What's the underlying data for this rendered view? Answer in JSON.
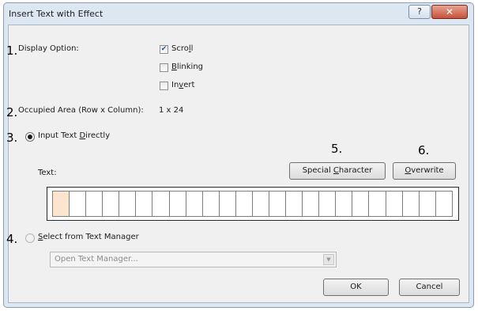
{
  "window": {
    "title": "Insert Text with Effect",
    "help_icon_glyph": "?",
    "close_icon_glyph": "✕"
  },
  "callouts": [
    "1.",
    "2.",
    "3.",
    "4.",
    "5.",
    "6."
  ],
  "display_option": {
    "label": "Display Option:",
    "checkboxes": [
      {
        "label": "Scroll",
        "checked": true
      },
      {
        "label": "Blinking",
        "checked": false
      },
      {
        "label": "Invert",
        "checked": false
      }
    ]
  },
  "occupied_area": {
    "label": "Occupied Area (Row x Column):",
    "value": "1 x 24"
  },
  "input_direct": {
    "label": "Input Text Directly",
    "selected": true
  },
  "text_field": {
    "label": "Text:",
    "columns": 24
  },
  "buttons": {
    "special_character": "Special Character",
    "overwrite": "Overwrite",
    "ok": "OK",
    "cancel": "Cancel"
  },
  "text_manager": {
    "label": "Select from Text Manager",
    "selected": false,
    "combo_value": "Open Text Manager...",
    "combo_enabled": false
  },
  "colors": {
    "active_cell": "#fbe5cf",
    "close_button": "#c7523a"
  }
}
